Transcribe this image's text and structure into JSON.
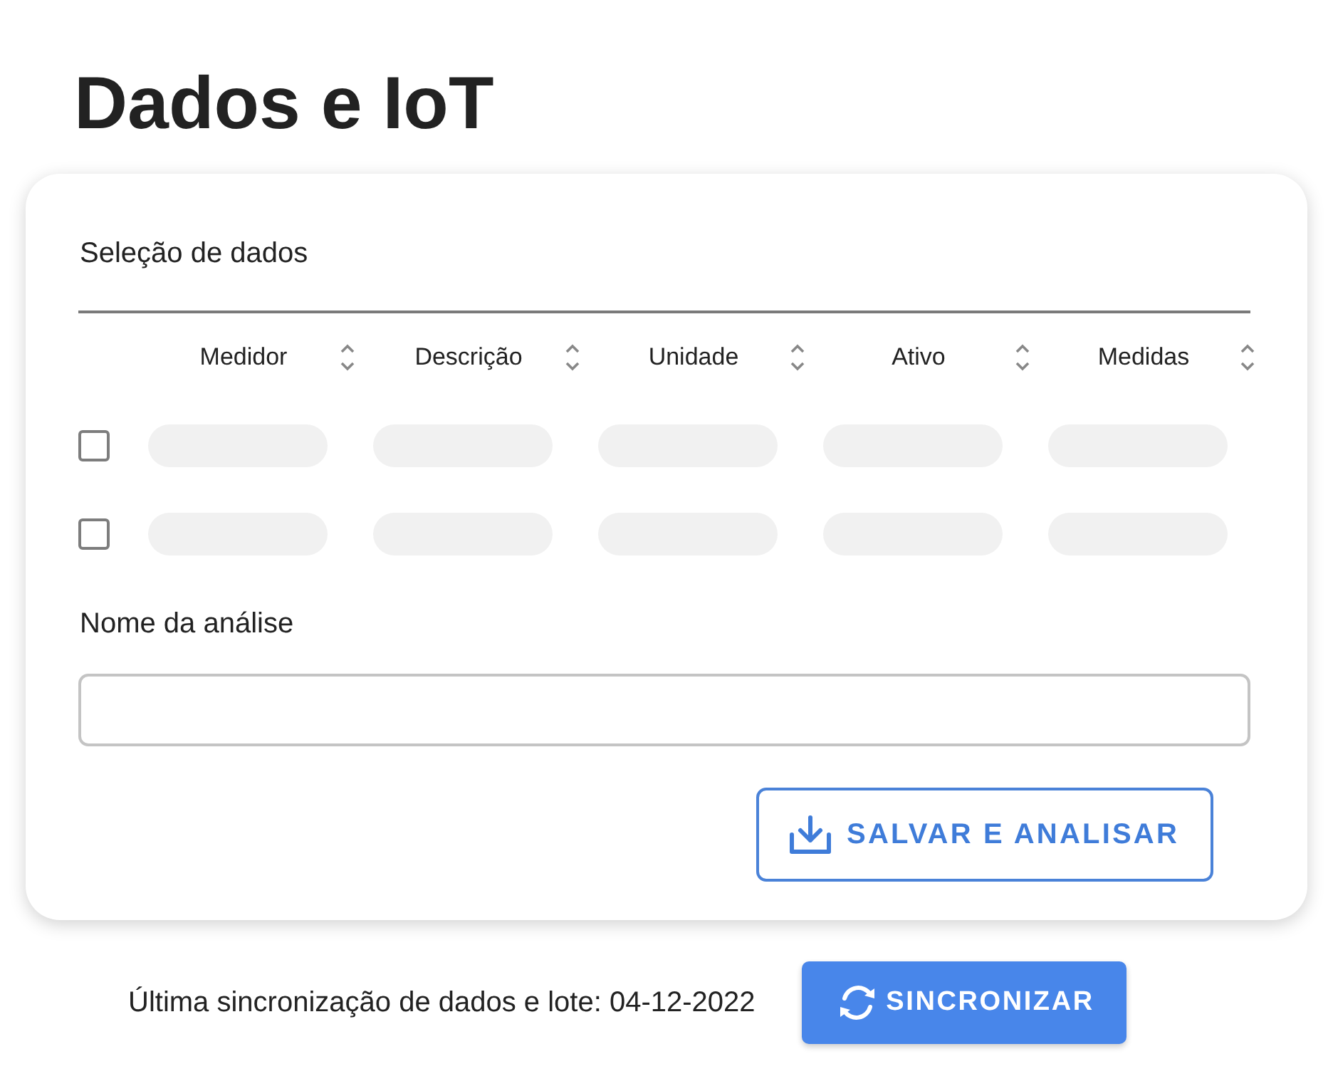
{
  "page": {
    "title": "Dados e IoT"
  },
  "selection": {
    "title": "Seleção de dados",
    "columns": [
      {
        "label": "Medidor"
      },
      {
        "label": "Descrição"
      },
      {
        "label": "Unidade"
      },
      {
        "label": "Ativo"
      },
      {
        "label": "Medidas"
      }
    ],
    "rows": [
      {
        "checked": false,
        "loading": true
      },
      {
        "checked": false,
        "loading": true
      }
    ]
  },
  "analysis_name": {
    "label": "Nome da análise"
  },
  "save_button": {
    "label": "SALVAR E ANALISAR"
  },
  "footer": {
    "sync_text": "Última sincronização de dados e lote: 04-12-2022",
    "sync_button": "SINCRONIZAR"
  }
}
